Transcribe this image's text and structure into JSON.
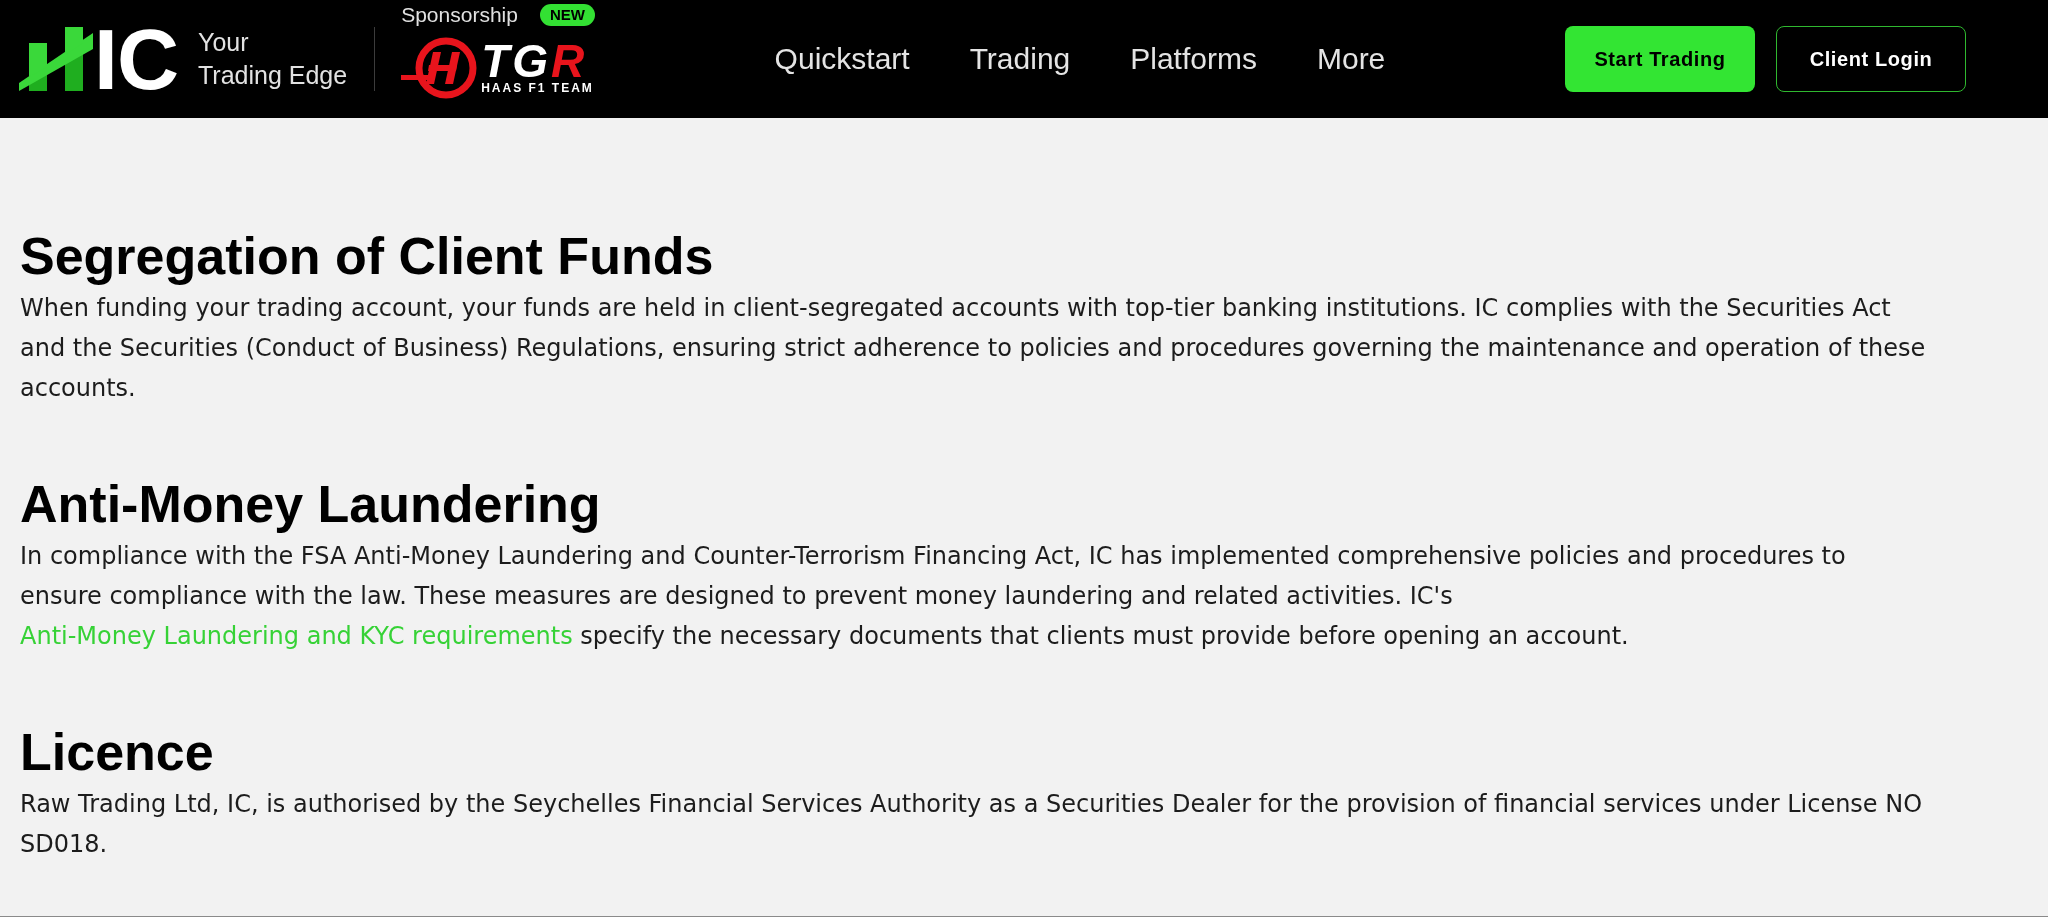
{
  "header": {
    "logo": {
      "wordmark": "IC",
      "tagline": [
        "Your",
        "Trading Edge"
      ]
    },
    "sponsorship": {
      "label": "Sponsorship",
      "badge": "NEW",
      "wordmark": "TGR",
      "team": "HAAS F1 TEAM"
    },
    "nav": [
      {
        "label": "Quickstart"
      },
      {
        "label": "Trading"
      },
      {
        "label": "Platforms"
      },
      {
        "label": "More"
      }
    ],
    "buttons": [
      {
        "label": "Start Trading",
        "kind": "primary"
      },
      {
        "label": "Client Login",
        "kind": "outline"
      }
    ]
  },
  "sections": [
    {
      "heading": "Segregation of Client Funds",
      "paragraph": [
        {
          "kind": "text",
          "text": "When funding your trading account, your funds are held in client-segregated accounts with top-tier banking institutions. IC complies with the Securities Act and the Securities (Conduct of Business) Regulations, ensuring strict adherence to policies and procedures governing the maintenance and operation of these accounts."
        }
      ]
    },
    {
      "heading": "Anti-Money Laundering",
      "paragraph": [
        {
          "kind": "text",
          "text": "In compliance with the FSA Anti-Money Laundering and Counter-Terrorism Financing Act, IC has implemented comprehensive policies and procedures to ensure compliance with the law. These measures are designed to prevent money laundering and related activities. IC's "
        },
        {
          "kind": "link",
          "text": "Anti-Money Laundering and KYC requirements"
        },
        {
          "kind": "text",
          "text": " specify the necessary documents that clients must provide before opening an account."
        }
      ]
    },
    {
      "heading": "Licence",
      "paragraph": [
        {
          "kind": "text",
          "text": "Raw Trading Ltd, IC, is authorised by the Seychelles Financial Services Authority as a Securities Dealer for the provision of financial services under License NO SD018."
        }
      ]
    }
  ]
}
